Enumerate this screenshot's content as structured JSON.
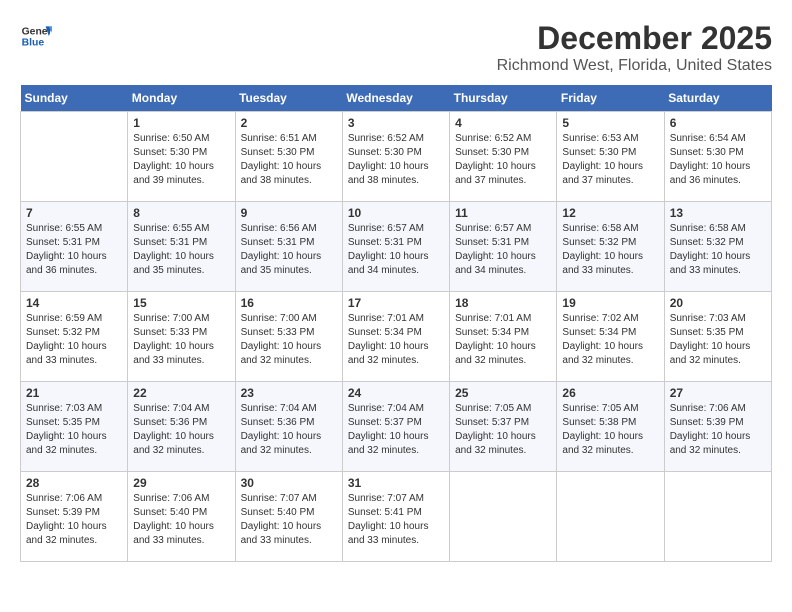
{
  "header": {
    "logo_line1": "General",
    "logo_line2": "Blue",
    "title": "December 2025",
    "subtitle": "Richmond West, Florida, United States"
  },
  "days_of_week": [
    "Sunday",
    "Monday",
    "Tuesday",
    "Wednesday",
    "Thursday",
    "Friday",
    "Saturday"
  ],
  "weeks": [
    [
      {
        "day": "",
        "info": ""
      },
      {
        "day": "1",
        "info": "Sunrise: 6:50 AM\nSunset: 5:30 PM\nDaylight: 10 hours\nand 39 minutes."
      },
      {
        "day": "2",
        "info": "Sunrise: 6:51 AM\nSunset: 5:30 PM\nDaylight: 10 hours\nand 38 minutes."
      },
      {
        "day": "3",
        "info": "Sunrise: 6:52 AM\nSunset: 5:30 PM\nDaylight: 10 hours\nand 38 minutes."
      },
      {
        "day": "4",
        "info": "Sunrise: 6:52 AM\nSunset: 5:30 PM\nDaylight: 10 hours\nand 37 minutes."
      },
      {
        "day": "5",
        "info": "Sunrise: 6:53 AM\nSunset: 5:30 PM\nDaylight: 10 hours\nand 37 minutes."
      },
      {
        "day": "6",
        "info": "Sunrise: 6:54 AM\nSunset: 5:30 PM\nDaylight: 10 hours\nand 36 minutes."
      }
    ],
    [
      {
        "day": "7",
        "info": "Sunrise: 6:55 AM\nSunset: 5:31 PM\nDaylight: 10 hours\nand 36 minutes."
      },
      {
        "day": "8",
        "info": "Sunrise: 6:55 AM\nSunset: 5:31 PM\nDaylight: 10 hours\nand 35 minutes."
      },
      {
        "day": "9",
        "info": "Sunrise: 6:56 AM\nSunset: 5:31 PM\nDaylight: 10 hours\nand 35 minutes."
      },
      {
        "day": "10",
        "info": "Sunrise: 6:57 AM\nSunset: 5:31 PM\nDaylight: 10 hours\nand 34 minutes."
      },
      {
        "day": "11",
        "info": "Sunrise: 6:57 AM\nSunset: 5:31 PM\nDaylight: 10 hours\nand 34 minutes."
      },
      {
        "day": "12",
        "info": "Sunrise: 6:58 AM\nSunset: 5:32 PM\nDaylight: 10 hours\nand 33 minutes."
      },
      {
        "day": "13",
        "info": "Sunrise: 6:58 AM\nSunset: 5:32 PM\nDaylight: 10 hours\nand 33 minutes."
      }
    ],
    [
      {
        "day": "14",
        "info": "Sunrise: 6:59 AM\nSunset: 5:32 PM\nDaylight: 10 hours\nand 33 minutes."
      },
      {
        "day": "15",
        "info": "Sunrise: 7:00 AM\nSunset: 5:33 PM\nDaylight: 10 hours\nand 33 minutes."
      },
      {
        "day": "16",
        "info": "Sunrise: 7:00 AM\nSunset: 5:33 PM\nDaylight: 10 hours\nand 32 minutes."
      },
      {
        "day": "17",
        "info": "Sunrise: 7:01 AM\nSunset: 5:34 PM\nDaylight: 10 hours\nand 32 minutes."
      },
      {
        "day": "18",
        "info": "Sunrise: 7:01 AM\nSunset: 5:34 PM\nDaylight: 10 hours\nand 32 minutes."
      },
      {
        "day": "19",
        "info": "Sunrise: 7:02 AM\nSunset: 5:34 PM\nDaylight: 10 hours\nand 32 minutes."
      },
      {
        "day": "20",
        "info": "Sunrise: 7:03 AM\nSunset: 5:35 PM\nDaylight: 10 hours\nand 32 minutes."
      }
    ],
    [
      {
        "day": "21",
        "info": "Sunrise: 7:03 AM\nSunset: 5:35 PM\nDaylight: 10 hours\nand 32 minutes."
      },
      {
        "day": "22",
        "info": "Sunrise: 7:04 AM\nSunset: 5:36 PM\nDaylight: 10 hours\nand 32 minutes."
      },
      {
        "day": "23",
        "info": "Sunrise: 7:04 AM\nSunset: 5:36 PM\nDaylight: 10 hours\nand 32 minutes."
      },
      {
        "day": "24",
        "info": "Sunrise: 7:04 AM\nSunset: 5:37 PM\nDaylight: 10 hours\nand 32 minutes."
      },
      {
        "day": "25",
        "info": "Sunrise: 7:05 AM\nSunset: 5:37 PM\nDaylight: 10 hours\nand 32 minutes."
      },
      {
        "day": "26",
        "info": "Sunrise: 7:05 AM\nSunset: 5:38 PM\nDaylight: 10 hours\nand 32 minutes."
      },
      {
        "day": "27",
        "info": "Sunrise: 7:06 AM\nSunset: 5:39 PM\nDaylight: 10 hours\nand 32 minutes."
      }
    ],
    [
      {
        "day": "28",
        "info": "Sunrise: 7:06 AM\nSunset: 5:39 PM\nDaylight: 10 hours\nand 32 minutes."
      },
      {
        "day": "29",
        "info": "Sunrise: 7:06 AM\nSunset: 5:40 PM\nDaylight: 10 hours\nand 33 minutes."
      },
      {
        "day": "30",
        "info": "Sunrise: 7:07 AM\nSunset: 5:40 PM\nDaylight: 10 hours\nand 33 minutes."
      },
      {
        "day": "31",
        "info": "Sunrise: 7:07 AM\nSunset: 5:41 PM\nDaylight: 10 hours\nand 33 minutes."
      },
      {
        "day": "",
        "info": ""
      },
      {
        "day": "",
        "info": ""
      },
      {
        "day": "",
        "info": ""
      }
    ]
  ]
}
